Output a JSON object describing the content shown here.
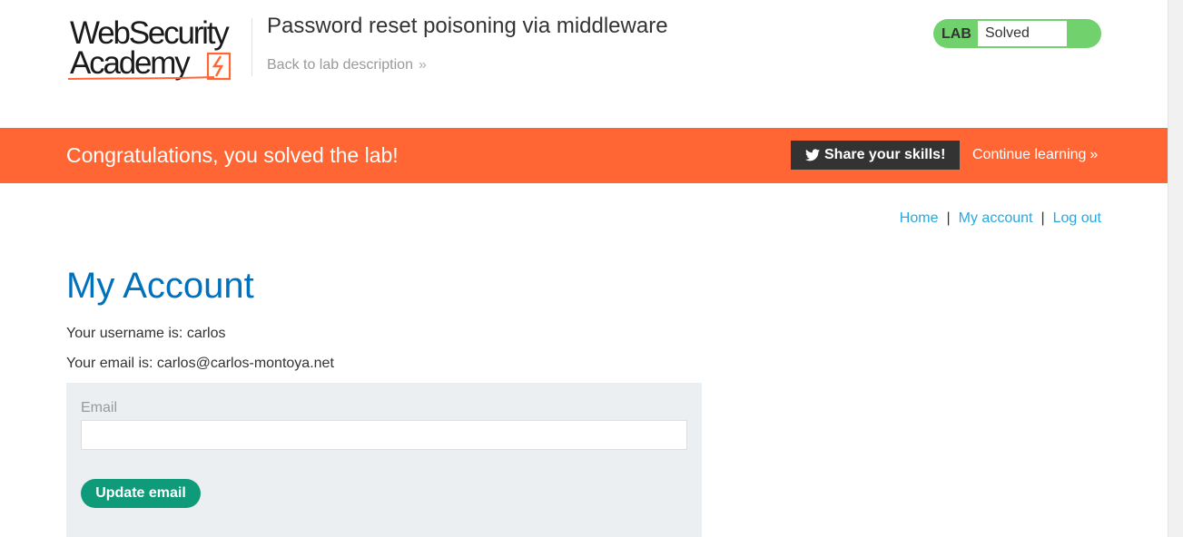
{
  "header": {
    "logo_line1": "WebSecurity",
    "logo_line2": "Academy",
    "lab_title": "Password reset poisoning via middleware",
    "back_link": "Back to lab description",
    "back_icon": "double-chevron-right-icon",
    "status_label": "LAB",
    "status_value": "Solved",
    "status_color": "#70d16d",
    "logo_accent_color": "#ff6633"
  },
  "banner": {
    "message": "Congratulations, you solved the lab!",
    "share_label": "Share your skills!",
    "share_icon": "twitter-icon",
    "continue_label": "Continue learning",
    "background_color": "#ff6633"
  },
  "nav": {
    "home": "Home",
    "separator": "|",
    "my_account": "My account",
    "log_out": "Log out"
  },
  "main": {
    "heading": "My Account",
    "username_line": "Your username is: carlos",
    "email_line": "Your email is: carlos@carlos-montoya.net",
    "form": {
      "email_label": "Email",
      "email_value": "",
      "submit_label": "Update email",
      "button_color": "#0f9b7a"
    }
  }
}
